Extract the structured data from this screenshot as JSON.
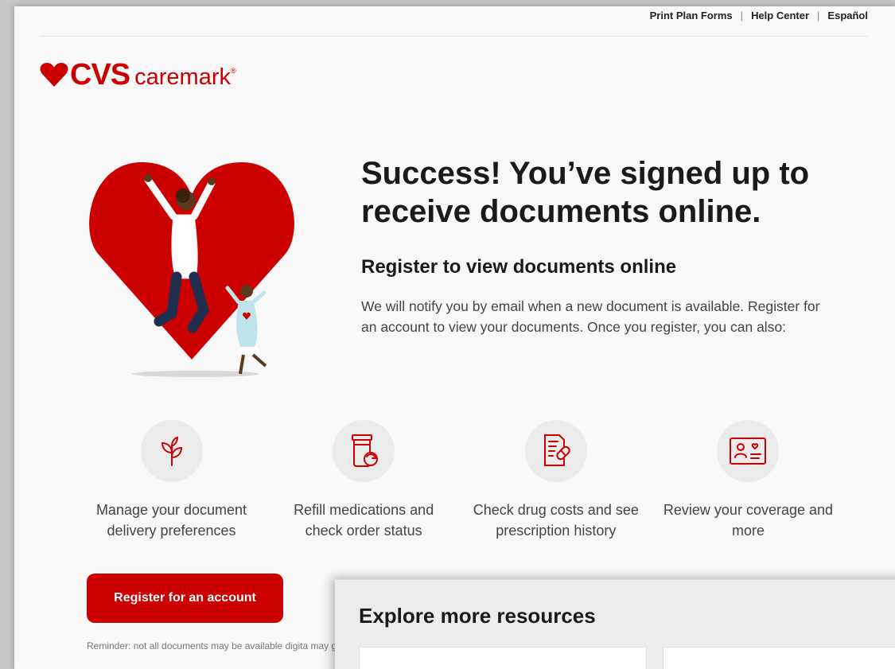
{
  "utility_nav": {
    "print_plan_forms": "Print Plan Forms",
    "help_center": "Help Center",
    "espanol": "Español",
    "separator": "|"
  },
  "logo": {
    "cvs": "CVS",
    "caremark": "caremark",
    "registered": "®"
  },
  "brand_colors": {
    "red": "#cc0000",
    "icon_bg": "#ebebeb"
  },
  "hero": {
    "headline": "Success! You’ve signed up to receive documents online.",
    "subhead": "Register to view documents online",
    "intro": "We will notify you by email when a new document is available. Register for an account to view your documents. Once you register, you can also:",
    "illustration": "heart-with-jumping-mother-and-daughter"
  },
  "features": [
    {
      "icon": "sprout-icon",
      "label": "Manage your document delivery preferences"
    },
    {
      "icon": "pill-bottle-refill-icon",
      "label": "Refill medications and check order status"
    },
    {
      "icon": "prescription-document-icon",
      "label": "Check drug costs and see prescription history"
    },
    {
      "icon": "member-id-card-icon",
      "label": "Review your coverage and more"
    }
  ],
  "register_button": "Register for an account",
  "reminder": "Reminder: not all documents may be available digita may get some paper statements until then. You may",
  "explore": {
    "title": "Explore more resources"
  }
}
